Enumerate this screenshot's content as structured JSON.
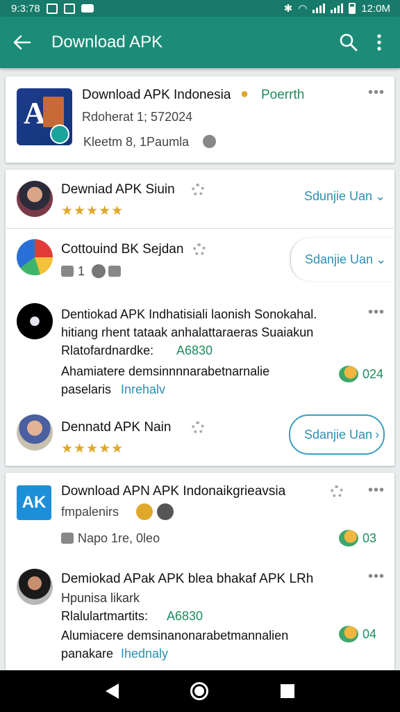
{
  "status": {
    "time_left": "9:3:78",
    "time_right": "12:0M"
  },
  "appbar": {
    "title": "Download APK"
  },
  "featured": {
    "title": "Download APK Indonesia",
    "badge_text": "Poerrth",
    "subtitle": "Rdoherat 1; 572024",
    "meta": "Kleetm 8, 1Paumla"
  },
  "group1": [
    {
      "name": "Dewniad APK Siuin",
      "rating": "★★★★★",
      "action": "Sdunjie Uan"
    },
    {
      "name": "Cottouind BK Sejdan",
      "stats": "1",
      "action": "Sdanjie Uan"
    },
    {
      "line1": "Dentiokad APK Indhatisiali laonish Sonokahal.",
      "line2": "hitiang rhent tataak anhalattaraeras Suaiakun",
      "line3_label": "Rlatofardnardke:",
      "line3_value": "A6830",
      "line4": "Ahamiatere demsinnnnarabetnarnalie",
      "line5a": "paselaris",
      "line5b": "Inrehalv",
      "count": "024"
    },
    {
      "name": "Dennatd APK Nain",
      "rating": "★★★★★",
      "action": "Sdanjie Uan"
    }
  ],
  "group2": [
    {
      "title": "Download APN APK Indonaikgrieavsia",
      "subtitle": "fmpalenirs",
      "meta": "Napo 1re, 0leo",
      "count": "03"
    },
    {
      "title": "Demiokad APak APK blea bhakaf APK LRh",
      "line2": "Hpunisa likark",
      "line3_label": "Rlalulartmartits:",
      "line3_value": "A6830",
      "line4": "Alumiacere demsinanonarabetmannalien",
      "line5a": "panakare",
      "line5b": "Ihednaly",
      "count": "04"
    }
  ],
  "icons": {
    "back": "arrow-back-icon",
    "search": "search-icon",
    "more": "more-vert-icon",
    "chevron": "chevron-down-icon",
    "gear": "gear-icon",
    "menu_dots": "more-horiz-icon"
  },
  "colors": {
    "primary": "#1c8c78",
    "status": "#187a6a",
    "accent": "#2a8fb2",
    "positive": "#1c8c5e",
    "star": "#e0a82a"
  }
}
